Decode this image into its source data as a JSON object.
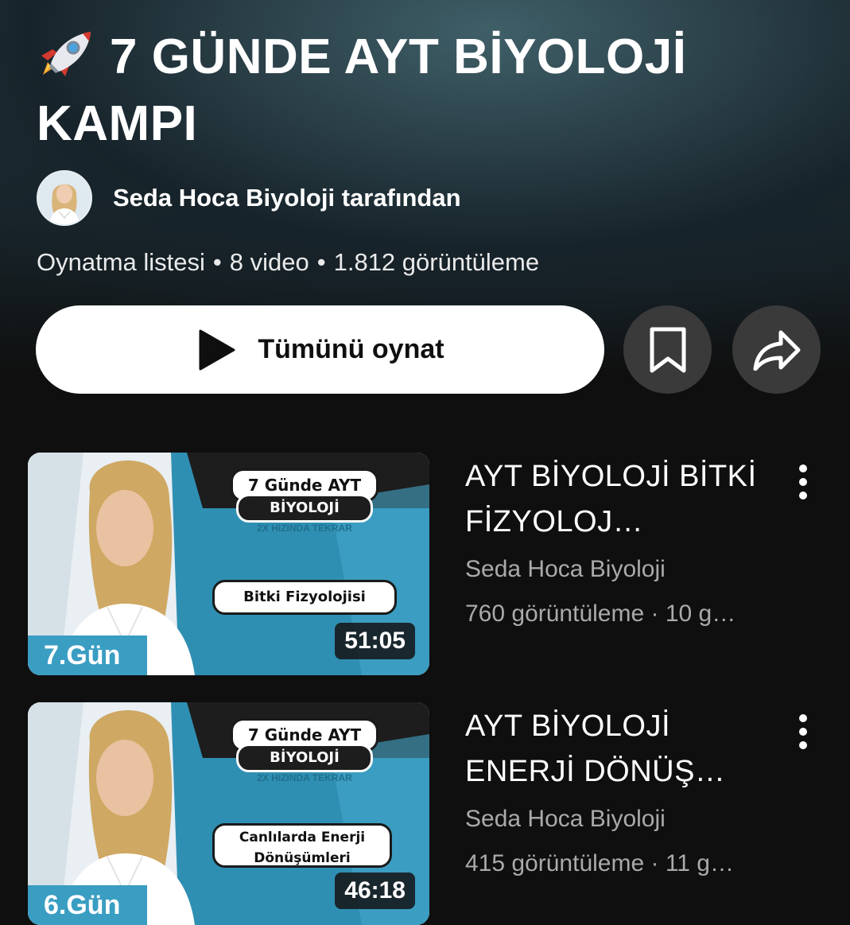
{
  "playlist": {
    "title": "7 GÜNDE AYT BİYOLOJİ KAMPI",
    "channel_by": "Seda Hoca Biyoloji tarafından",
    "meta": {
      "type": "Oynatma listesi",
      "video_count": "8 video",
      "views": "1.812 görüntüleme"
    },
    "play_all_label": "Tümünü oynat"
  },
  "icons": {
    "title_emoji": "rocket-icon",
    "play": "play-icon",
    "save": "bookmark-icon",
    "share": "share-icon",
    "more": "more-vert-icon"
  },
  "videos": [
    {
      "title": "AYT BİYOLOJİ BİTKİ FİZYOLOJ…",
      "channel": "Seda Hoca Biyoloji",
      "stats": "760 görüntüleme · 10 g…",
      "duration": "51:05",
      "thumb": {
        "headline_line1": "7 Günde AYT",
        "headline_line2": "BİYOLOJİ",
        "subtitle": "2X HIZINDA TEKRAR",
        "topic": "Bitki Fizyolojisi",
        "day": "7.Gün"
      }
    },
    {
      "title": "AYT BİYOLOJİ ENERJİ DÖNÜŞ…",
      "channel": "Seda Hoca Biyoloji",
      "stats": "415 görüntüleme · 11 g…",
      "duration": "46:18",
      "thumb": {
        "headline_line1": "7 Günde AYT",
        "headline_line2": "BİYOLOJİ",
        "subtitle": "2X HIZINDA TEKRAR",
        "topic": "Canlılarda Enerji Dönüşümleri",
        "day": "6.Gün"
      }
    }
  ]
}
